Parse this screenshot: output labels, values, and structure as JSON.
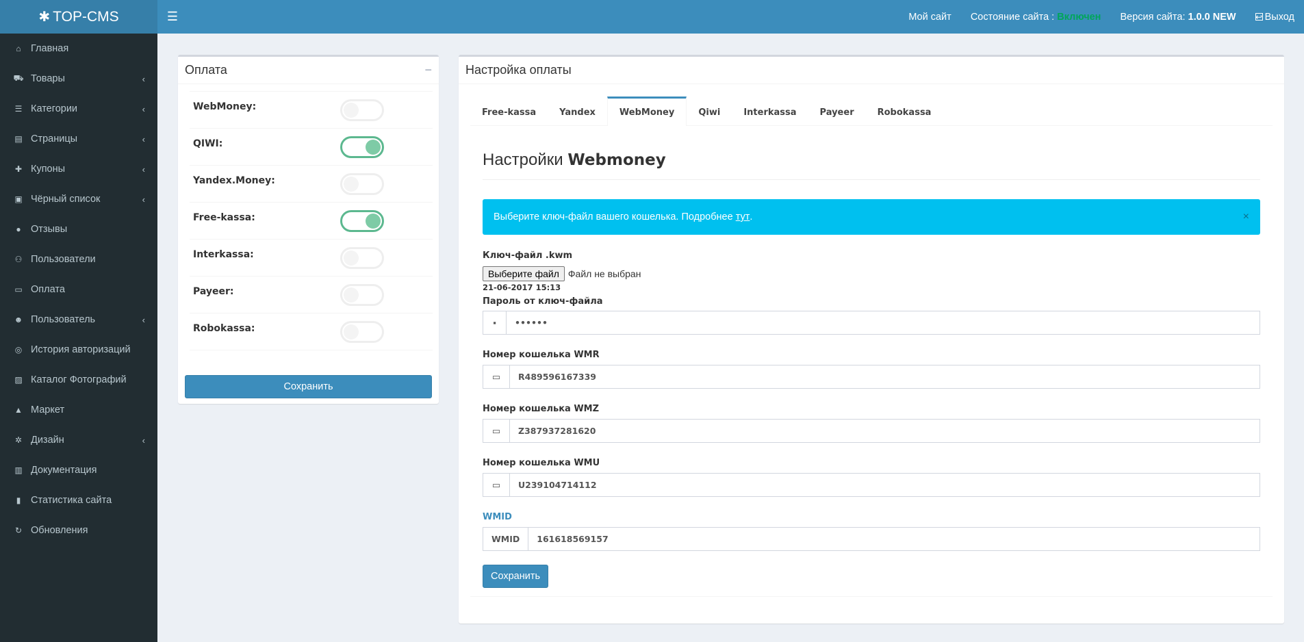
{
  "header": {
    "logo": "TOP-CMS",
    "my_site": "Мой сайт",
    "status_label": "Состояние сайта :",
    "status_value": "Включен",
    "version_label": "Версия сайта:",
    "version_value": "1.0.0 NEW",
    "logout": "Выход"
  },
  "sidebar": {
    "items": [
      {
        "label": "Главная",
        "icon": "home-icon"
      },
      {
        "label": "Товары",
        "icon": "cart-icon"
      },
      {
        "label": "Категории",
        "icon": "list-icon"
      },
      {
        "label": "Страницы",
        "icon": "file-icon"
      },
      {
        "label": "Купоны",
        "icon": "gift-icon"
      },
      {
        "label": "Чёрный список",
        "icon": "lock-icon"
      },
      {
        "label": "Отзывы",
        "icon": "comments-icon"
      },
      {
        "label": "Пользователи",
        "icon": "users-icon"
      },
      {
        "label": "Оплата",
        "icon": "money-icon"
      },
      {
        "label": "Пользователь",
        "icon": "user-icon"
      },
      {
        "label": "История авторизаций",
        "icon": "eye-slash-icon"
      },
      {
        "label": "Каталог Фотографий",
        "icon": "image-icon"
      },
      {
        "label": "Маркет",
        "icon": "flask-icon"
      },
      {
        "label": "Дизайн",
        "icon": "cogs-icon"
      },
      {
        "label": "Документация",
        "icon": "book-icon"
      },
      {
        "label": "Статистика сайта",
        "icon": "bar-chart-icon"
      },
      {
        "label": "Обновления",
        "icon": "refresh-icon"
      }
    ]
  },
  "payment_box": {
    "title": "Оплата",
    "methods": [
      {
        "label": "WebMoney:",
        "enabled": false
      },
      {
        "label": "QIWI:",
        "enabled": true
      },
      {
        "label": "Yandex.Money:",
        "enabled": false
      },
      {
        "label": "Free-kassa:",
        "enabled": true
      },
      {
        "label": "Interkassa:",
        "enabled": false
      },
      {
        "label": "Payeer:",
        "enabled": false
      },
      {
        "label": "Robokassa:",
        "enabled": false
      }
    ],
    "save_label": "Сохранить"
  },
  "settings_box": {
    "title": "Настройка оплаты",
    "tabs": [
      "Free-kassa",
      "Yandex",
      "WebMoney",
      "Qiwi",
      "Interkassa",
      "Payeer",
      "Robokassa"
    ],
    "active_tab": "WebMoney",
    "heading_prefix": "Настройки",
    "heading_bold": "Webmoney",
    "alert_text": "Выберите ключ-файл вашего кошелька. Подробнее",
    "alert_link": "тут",
    "alert_dot": ".",
    "alert_close": "×",
    "keyfile_label": "Ключ-файл .kwm",
    "file_button": "Выберите файл",
    "file_status": "Файл не выбран",
    "file_stamp": "21-06-2017 15:13",
    "password_label": "Пароль от ключ-файла",
    "password_value": "••••••",
    "wmr_label": "Номер кошелька WMR",
    "wmr_value": "R489596167339",
    "wmz_label": "Номер кошелька WMZ",
    "wmz_value": "Z387937281620",
    "wmu_label": "Номер кошелька WMU",
    "wmu_value": "U239104714112",
    "wmid_label": "WMID",
    "wmid_addon": "WMID",
    "wmid_value": "161618569157",
    "save_label": "Сохранить"
  },
  "colors": {
    "header": "#3c8dbc",
    "logo_bg": "#367fa9",
    "sidebar": "#222d32",
    "status_on": "#00a65a",
    "alert": "#00c0ef",
    "toggle_on": "#7ecba6"
  }
}
